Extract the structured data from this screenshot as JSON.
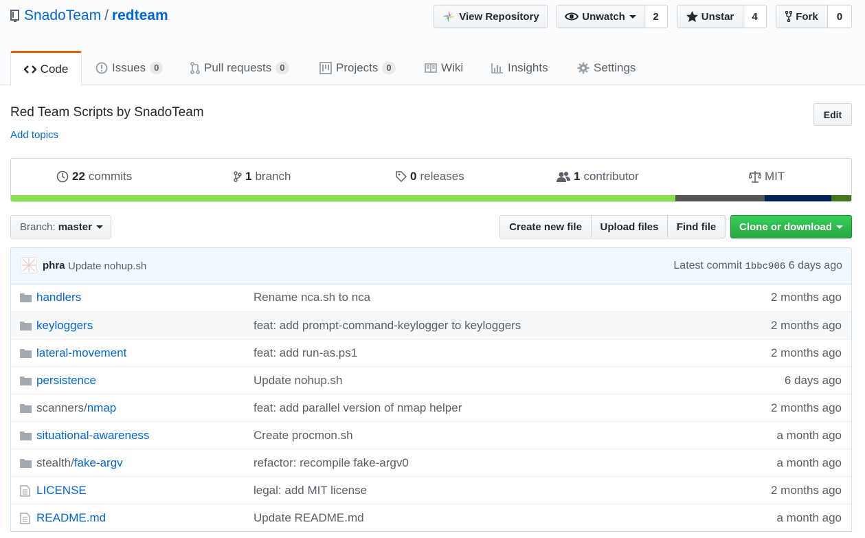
{
  "repo": {
    "owner": "SnadoTeam",
    "separator": "/",
    "name": "redteam"
  },
  "actions": {
    "view_repository": "View Repository",
    "unwatch": "Unwatch",
    "watch_count": "2",
    "unstar": "Unstar",
    "star_count": "4",
    "fork": "Fork",
    "fork_count": "0"
  },
  "tabs": [
    {
      "label": "Code"
    },
    {
      "label": "Issues",
      "count": "0"
    },
    {
      "label": "Pull requests",
      "count": "0"
    },
    {
      "label": "Projects",
      "count": "0"
    },
    {
      "label": "Wiki"
    },
    {
      "label": "Insights"
    },
    {
      "label": "Settings"
    }
  ],
  "description": "Red Team Scripts by SnadoTeam",
  "add_topics": "Add topics",
  "edit_label": "Edit",
  "summary": {
    "commits_num": "22",
    "commits_label": "commits",
    "branches_num": "1",
    "branches_label": "branch",
    "releases_num": "0",
    "releases_label": "releases",
    "contributors_num": "1",
    "contributors_label": "contributor",
    "license": "MIT"
  },
  "language_bar": [
    {
      "color": "#89e051",
      "fraction": 0.789
    },
    {
      "color": "#555555",
      "fraction": 0.106
    },
    {
      "color": "#012456",
      "fraction": 0.079
    },
    {
      "color": "#427819",
      "fraction": 0.026
    }
  ],
  "branch": {
    "label": "Branch:",
    "value": "master"
  },
  "file_actions": {
    "create": "Create new file",
    "upload": "Upload files",
    "find": "Find file",
    "clone": "Clone or download"
  },
  "latest_commit": {
    "author": "phra",
    "message": "Update nohup.sh",
    "label": "Latest commit",
    "sha": "1bbc906",
    "age": "6 days ago"
  },
  "files": [
    {
      "type": "dir",
      "prefix": "",
      "name": "handlers",
      "message": "Rename nca.sh to nca",
      "age": "2 months ago"
    },
    {
      "type": "dir",
      "prefix": "",
      "name": "keyloggers",
      "message": "feat: add prompt-command-keylogger to keyloggers",
      "age": "2 months ago"
    },
    {
      "type": "dir",
      "prefix": "",
      "name": "lateral-movement",
      "message": "feat: add run-as.ps1",
      "age": "2 months ago"
    },
    {
      "type": "dir",
      "prefix": "",
      "name": "persistence",
      "message": "Update nohup.sh",
      "age": "6 days ago"
    },
    {
      "type": "dir",
      "prefix": "scanners/",
      "name": "nmap",
      "message": "feat: add parallel version of nmap helper",
      "age": "2 months ago"
    },
    {
      "type": "dir",
      "prefix": "",
      "name": "situational-awareness",
      "message": "Create procmon.sh",
      "age": "a month ago"
    },
    {
      "type": "dir",
      "prefix": "stealth/",
      "name": "fake-argv",
      "message": "refactor: recompile fake-argv0",
      "age": "a month ago"
    },
    {
      "type": "file",
      "prefix": "",
      "name": "LICENSE",
      "message": "legal: add MIT license",
      "age": "2 months ago"
    },
    {
      "type": "file",
      "prefix": "",
      "name": "README.md",
      "message": "Update README.md",
      "age": "a month ago"
    }
  ]
}
